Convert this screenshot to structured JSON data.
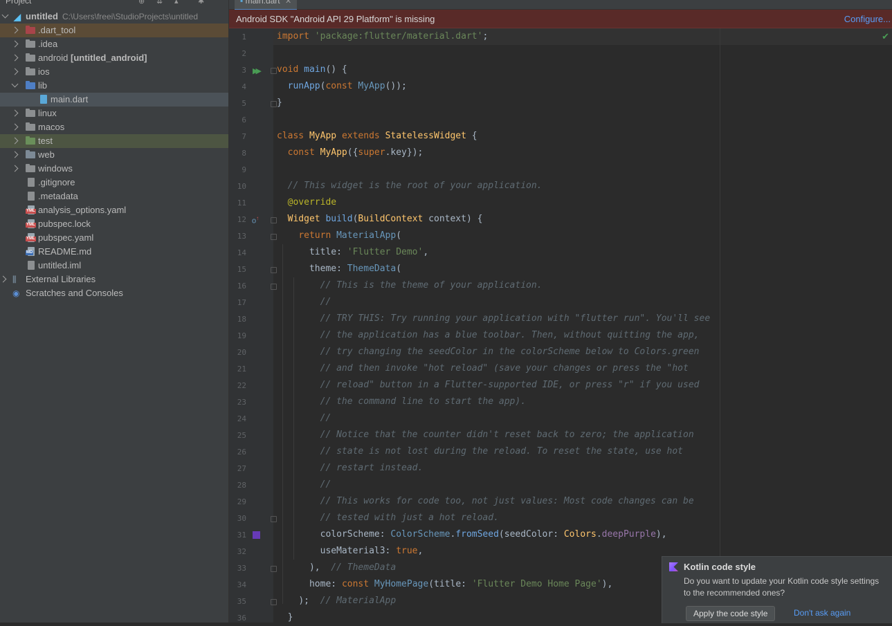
{
  "project_panel": {
    "title": "Project",
    "root": {
      "name": "untitled",
      "path": "C:\\Users\\freei\\StudioProjects\\untitled"
    },
    "items": [
      {
        "label": ".dart_tool"
      },
      {
        "label": ".idea"
      },
      {
        "label": "android",
        "bold": "[untitled_android]"
      },
      {
        "label": "ios"
      },
      {
        "label": "lib"
      },
      {
        "label": "main.dart"
      },
      {
        "label": "linux"
      },
      {
        "label": "macos"
      },
      {
        "label": "test"
      },
      {
        "label": "web"
      },
      {
        "label": "windows"
      },
      {
        "label": ".gitignore"
      },
      {
        "label": ".metadata"
      },
      {
        "label": "analysis_options.yaml"
      },
      {
        "label": "pubspec.lock"
      },
      {
        "label": "pubspec.yaml"
      },
      {
        "label": "README.md"
      },
      {
        "label": "untitled.iml"
      },
      {
        "label": "External Libraries"
      },
      {
        "label": "Scratches and Consoles"
      }
    ],
    "badges": {
      "yml": "YML",
      "md": "MD"
    }
  },
  "editor": {
    "tab": {
      "label": "main.dart"
    },
    "banner": {
      "message": "Android SDK \"Android API 29 Platform\" is missing",
      "action": "Configure..."
    },
    "line_numbers": [
      "1",
      "2",
      "3",
      "4",
      "5",
      "6",
      "7",
      "8",
      "9",
      "10",
      "11",
      "12",
      "13",
      "14",
      "15",
      "16",
      "17",
      "18",
      "19",
      "20",
      "21",
      "22",
      "23",
      "24",
      "25",
      "26",
      "27",
      "28",
      "29",
      "30",
      "31",
      "32",
      "33",
      "34",
      "35",
      "36"
    ],
    "code": {
      "l1": {
        "kw": "import",
        "str": "'package:flutter/material.dart'",
        "pun": ";"
      },
      "l3": {
        "kw": "void",
        "fn": "main",
        "pun": "() {"
      },
      "l4": {
        "fn": "runApp",
        "p1": "(",
        "kw": "const",
        "cls": "MyApp",
        "p2": "());"
      },
      "l5": {
        "pun": "}"
      },
      "l7": {
        "kw": "class",
        "cls": "MyApp",
        "kw2": "extends",
        "typ": "StatelessWidget",
        "pun": "{"
      },
      "l8": {
        "kw": "const",
        "cls": "MyApp",
        "p1": "({",
        "kw2": "super",
        "p2": ".key});"
      },
      "l10": {
        "cm": "// This widget is the root of your application."
      },
      "l11": {
        "an": "@override"
      },
      "l12": {
        "cls": "Widget",
        "fn": "build",
        "p1": "(",
        "typ": "BuildContext",
        "p2": " context) {"
      },
      "l13": {
        "kw": "return",
        "typ": "MaterialApp",
        "pun": "("
      },
      "l14": {
        "plain": "title: ",
        "str": "'Flutter Demo'",
        "pun": ","
      },
      "l15": {
        "plain": "theme: ",
        "typ": "ThemeData",
        "pun": "("
      },
      "l16": {
        "cm": "// This is the theme of your application."
      },
      "l17": {
        "cm": "//"
      },
      "l18": {
        "cm": "// TRY THIS: Try running your application with \"flutter run\". You'll see"
      },
      "l19": {
        "cm": "// the application has a blue toolbar. Then, without quitting the app,"
      },
      "l20": {
        "cm": "// try changing the seedColor in the colorScheme below to Colors.green"
      },
      "l21": {
        "cm": "// and then invoke \"hot reload\" (save your changes or press the \"hot"
      },
      "l22": {
        "cm": "// reload\" button in a Flutter-supported IDE, or press \"r\" if you used"
      },
      "l23": {
        "cm": "// the command line to start the app)."
      },
      "l24": {
        "cm": "//"
      },
      "l25": {
        "cm": "// Notice that the counter didn't reset back to zero; the application"
      },
      "l26": {
        "cm": "// state is not lost during the reload. To reset the state, use hot"
      },
      "l27": {
        "cm": "// restart instead."
      },
      "l28": {
        "cm": "//"
      },
      "l29": {
        "cm": "// This works for code too, not just values: Most code changes can be"
      },
      "l30": {
        "cm": "// tested with just a hot reload."
      },
      "l31": {
        "plain": "colorScheme: ",
        "typ": "ColorScheme",
        "p1": ".",
        "fn": "fromSeed",
        "p2": "(seedColor: ",
        "cls": "Colors",
        "p3": ".",
        "prop": "deepPurple",
        "p4": "),"
      },
      "l32": {
        "plain": "useMaterial3: ",
        "kw": "true",
        "pun": ","
      },
      "l33": {
        "pun": "),",
        "cm": "// ThemeData"
      },
      "l34": {
        "plain": "home: ",
        "kw": "const",
        "typ": "MyHomePage",
        "p1": "(title: ",
        "str": "'Flutter Demo Home Page'",
        "p2": "),"
      },
      "l35": {
        "pun": ");",
        "cm": "// MaterialApp"
      },
      "l36": {
        "pun": "}"
      }
    }
  },
  "notification": {
    "title": "Kotlin code style",
    "body": "Do you want to update your Kotlin code style settings to the recommended ones?",
    "apply_button": "Apply the code style",
    "dismiss_link": "Don't ask again"
  },
  "colors": {
    "swatch": "#673ab7",
    "banner_bg": "#592a28",
    "link": "#589df6"
  },
  "icons": {
    "run": "run-gutter-icon",
    "override": "override-gutter-icon",
    "check": "inspection-ok-icon",
    "kotlin": "kotlin-logo-icon"
  }
}
